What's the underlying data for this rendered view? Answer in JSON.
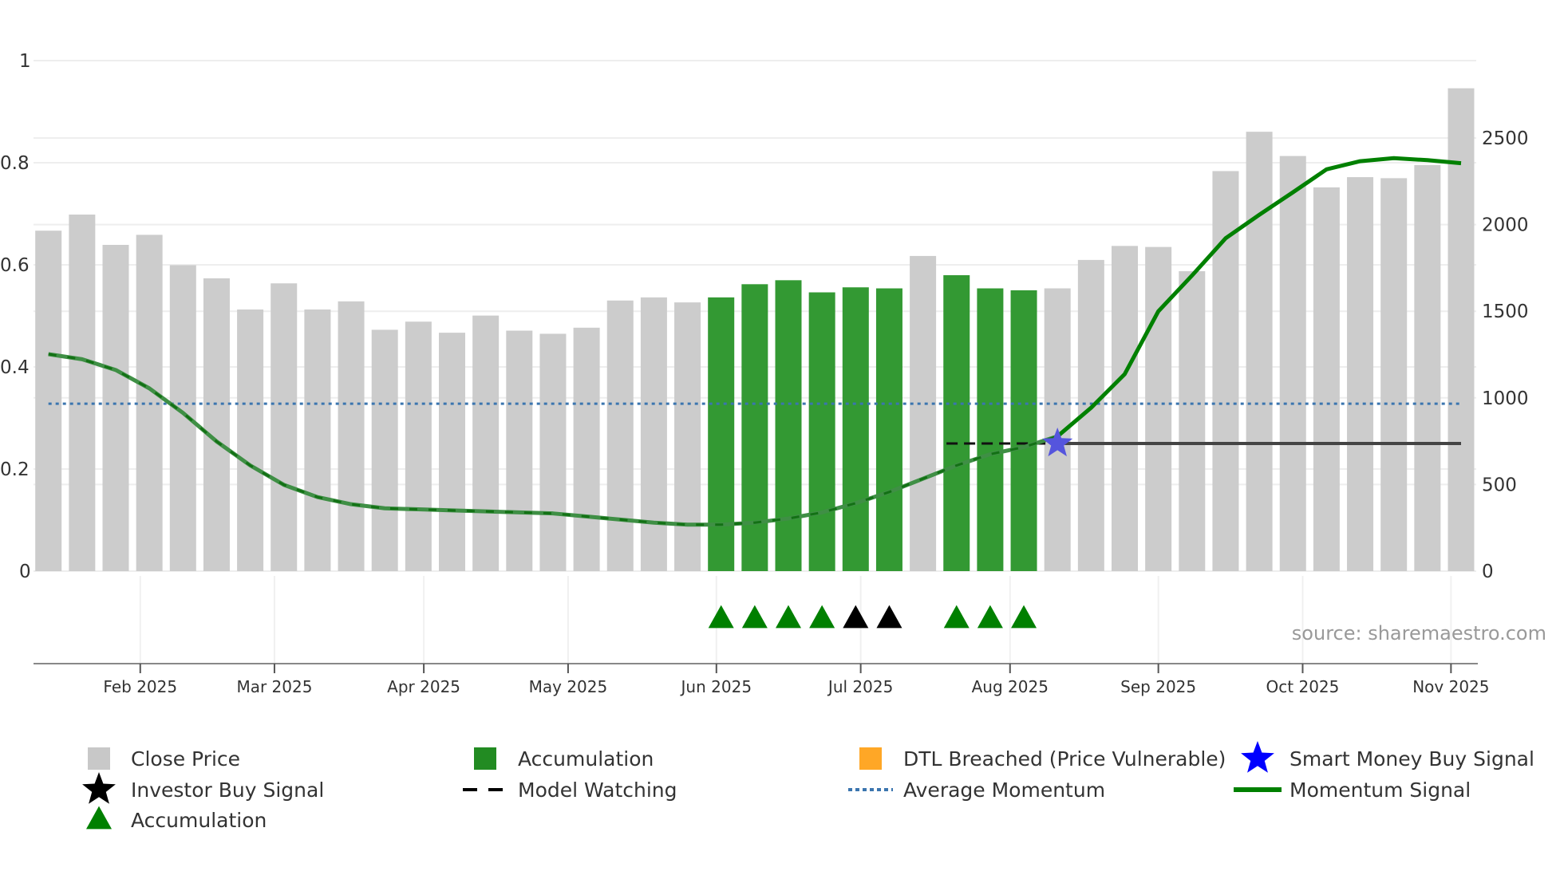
{
  "chart_data": {
    "type": "bar+line",
    "x_unit": "weekly bar index",
    "left_axis": {
      "ylim": [
        0,
        1
      ],
      "ticks": [
        "0",
        "0.2",
        "0.4",
        "0.6",
        "0.8",
        "1"
      ],
      "tick_values": [
        0,
        0.2,
        0.4,
        0.6,
        0.8,
        1
      ]
    },
    "right_axis": {
      "ylim": [
        0,
        2950
      ],
      "ticks": [
        "0",
        "500",
        "1000",
        "1500",
        "2000",
        "2500"
      ],
      "tick_values": [
        0,
        500,
        1000,
        1500,
        2000,
        2500
      ]
    },
    "x_ticks": [
      {
        "label": "Feb 2025",
        "x": 2.73
      },
      {
        "label": "Mar 2025",
        "x": 6.72
      },
      {
        "label": "Apr 2025",
        "x": 11.16
      },
      {
        "label": "May 2025",
        "x": 15.45
      },
      {
        "label": "Jun 2025",
        "x": 19.86
      },
      {
        "label": "Jul 2025",
        "x": 24.15
      },
      {
        "label": "Aug 2025",
        "x": 28.59
      },
      {
        "label": "Sep 2025",
        "x": 33.0
      },
      {
        "label": "Oct 2025",
        "x": 37.29
      },
      {
        "label": "Nov 2025",
        "x": 41.7
      }
    ],
    "close_price": [
      1965,
      2058,
      1883,
      1941,
      1766,
      1690,
      1510,
      1661,
      1510,
      1557,
      1393,
      1440,
      1376,
      1475,
      1388,
      1370,
      1405,
      1562,
      1580,
      1551,
      1580,
      1656,
      1679,
      1609,
      1638,
      1632,
      1819,
      1708,
      1632,
      1621,
      1632,
      1796,
      1877,
      1871,
      1731,
      2309,
      2536,
      2396,
      2215,
      2274,
      2268,
      2344,
      2787
    ],
    "accumulation_bars": [
      20,
      21,
      22,
      23,
      24,
      25,
      27,
      28,
      29
    ],
    "momentum_signal": [
      0.425,
      0.415,
      0.394,
      0.358,
      0.31,
      0.254,
      0.207,
      0.169,
      0.145,
      0.131,
      0.123,
      0.121,
      0.119,
      0.117,
      0.115,
      0.113,
      0.107,
      0.101,
      0.095,
      0.091,
      0.091,
      0.095,
      0.103,
      0.115,
      0.133,
      0.155,
      0.181,
      0.207,
      0.229,
      0.243,
      0.264,
      0.32,
      0.386,
      0.509,
      0.579,
      0.652,
      0.698,
      0.742,
      0.787,
      0.803,
      0.809,
      0.805,
      0.799
    ],
    "average_momentum": 0.328,
    "model_watching": {
      "value": 0.25,
      "from": 26.7,
      "to": 42
    },
    "smart_money_buy_signal": {
      "x": 30,
      "y": 0.25
    },
    "accumulation_triangles": [
      20,
      21,
      22,
      23,
      27,
      28,
      29
    ],
    "investor_buy_triangles": [
      24,
      25
    ],
    "source": "source: sharemaestro.com",
    "legend": [
      {
        "label": "Close Price",
        "icon": "square",
        "color": "#c8c8c8"
      },
      {
        "label": "Accumulation",
        "icon": "square",
        "color": "#228b22"
      },
      {
        "label": "DTL Breached (Price Vulnerable)",
        "icon": "square",
        "color": "#ffa726"
      },
      {
        "label": "Smart Money Buy Signal",
        "icon": "star",
        "color": "#0000ff"
      },
      {
        "label": "Investor Buy Signal",
        "icon": "star",
        "color": "#000000"
      },
      {
        "label": "Model Watching",
        "icon": "dash",
        "color": "#000000"
      },
      {
        "label": "Average Momentum",
        "icon": "dot",
        "color": "#3b75af"
      },
      {
        "label": "Momentum Signal",
        "icon": "line",
        "color": "#008000"
      },
      {
        "label": "Accumulation",
        "icon": "triangle",
        "color": "#008000"
      }
    ],
    "colors": {
      "bar": "#cccccc",
      "acc_bar": "#339933",
      "momentum": "#008000",
      "avg": "#3b75af",
      "star": "#5555dd"
    }
  }
}
